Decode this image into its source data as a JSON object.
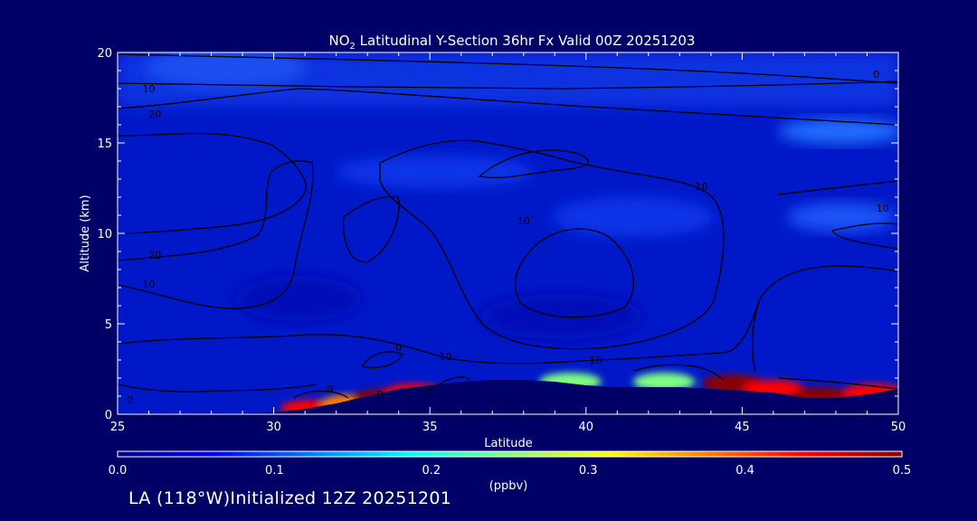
{
  "chart_data": {
    "type": "heatmap",
    "title_prefix": "NO",
    "title_sub": "2",
    "title_suffix": " Latitudinal Y-Section 36hr  Fx Valid 00Z 20251203",
    "xlabel": "Latitude",
    "ylabel": "Altitude (km)",
    "xlim": [
      25,
      50
    ],
    "ylim": [
      0,
      20
    ],
    "xticks": [
      "25",
      "30",
      "35",
      "40",
      "45",
      "50"
    ],
    "yticks": [
      "0",
      "5",
      "10",
      "15",
      "20"
    ],
    "colorbar": {
      "min": 0.0,
      "max": 0.5,
      "ticks": [
        "0.0",
        "0.1",
        "0.2",
        "0.3",
        "0.4",
        "0.5"
      ],
      "label": "(ppbv)",
      "stops": [
        "#00008b",
        "#0000ff",
        "#0080ff",
        "#00ffff",
        "#80ff80",
        "#ffff00",
        "#ff8000",
        "#ff0000",
        "#8b0000"
      ]
    },
    "terrain_km": [
      [
        25,
        0
      ],
      [
        28,
        0
      ],
      [
        30,
        0.1
      ],
      [
        31,
        0.3
      ],
      [
        32,
        0.6
      ],
      [
        33,
        1.0
      ],
      [
        34,
        1.4
      ],
      [
        35,
        1.6
      ],
      [
        36,
        1.8
      ],
      [
        37,
        1.9
      ],
      [
        38,
        1.9
      ],
      [
        39,
        1.8
      ],
      [
        40,
        1.6
      ],
      [
        41,
        1.5
      ],
      [
        42,
        1.5
      ],
      [
        43,
        1.5
      ],
      [
        44,
        1.4
      ],
      [
        45,
        1.3
      ],
      [
        46,
        1.2
      ],
      [
        47,
        0.9
      ],
      [
        48,
        0.9
      ],
      [
        49,
        1.1
      ],
      [
        50,
        1.4
      ]
    ],
    "surface_no2": [
      {
        "x": 31.2,
        "y": 0.3,
        "ppbv": 0.45
      },
      {
        "x": 32.5,
        "y": 0.6,
        "ppbv": 0.4
      },
      {
        "x": 33.5,
        "y": 0.9,
        "ppbv": 0.5
      },
      {
        "x": 34.5,
        "y": 1.2,
        "ppbv": 0.42
      },
      {
        "x": 44.7,
        "y": 1.7,
        "ppbv": 0.5
      },
      {
        "x": 46.0,
        "y": 1.4,
        "ppbv": 0.45
      },
      {
        "x": 47.5,
        "y": 1.0,
        "ppbv": 0.48
      },
      {
        "x": 49.2,
        "y": 1.2,
        "ppbv": 0.45
      },
      {
        "x": 39.5,
        "y": 1.8,
        "ppbv": 0.28
      },
      {
        "x": 42.5,
        "y": 1.8,
        "ppbv": 0.22
      }
    ],
    "contour_labels": [
      {
        "text": "10",
        "x": 26.0,
        "y": 17.8
      },
      {
        "text": "20",
        "x": 26.2,
        "y": 16.4
      },
      {
        "text": "20",
        "x": 26.2,
        "y": 8.6
      },
      {
        "text": "10",
        "x": 26.0,
        "y": 7.0
      },
      {
        "text": "0",
        "x": 25.4,
        "y": 0.6
      },
      {
        "text": "0",
        "x": 49.3,
        "y": 18.6
      },
      {
        "text": "10",
        "x": 49.5,
        "y": 11.2
      },
      {
        "text": "10",
        "x": 43.7,
        "y": 12.4
      },
      {
        "text": "10",
        "x": 38.0,
        "y": 10.5
      },
      {
        "text": "10",
        "x": 35.5,
        "y": 3.0
      },
      {
        "text": "10",
        "x": 40.3,
        "y": 2.8
      },
      {
        "text": "0",
        "x": 34.0,
        "y": 3.5
      },
      {
        "text": "0",
        "x": 31.8,
        "y": 1.2
      },
      {
        "text": "0",
        "x": 33.4,
        "y": 0.9
      }
    ]
  },
  "footer": "LA (118°W)Initialized 12Z 20251201"
}
